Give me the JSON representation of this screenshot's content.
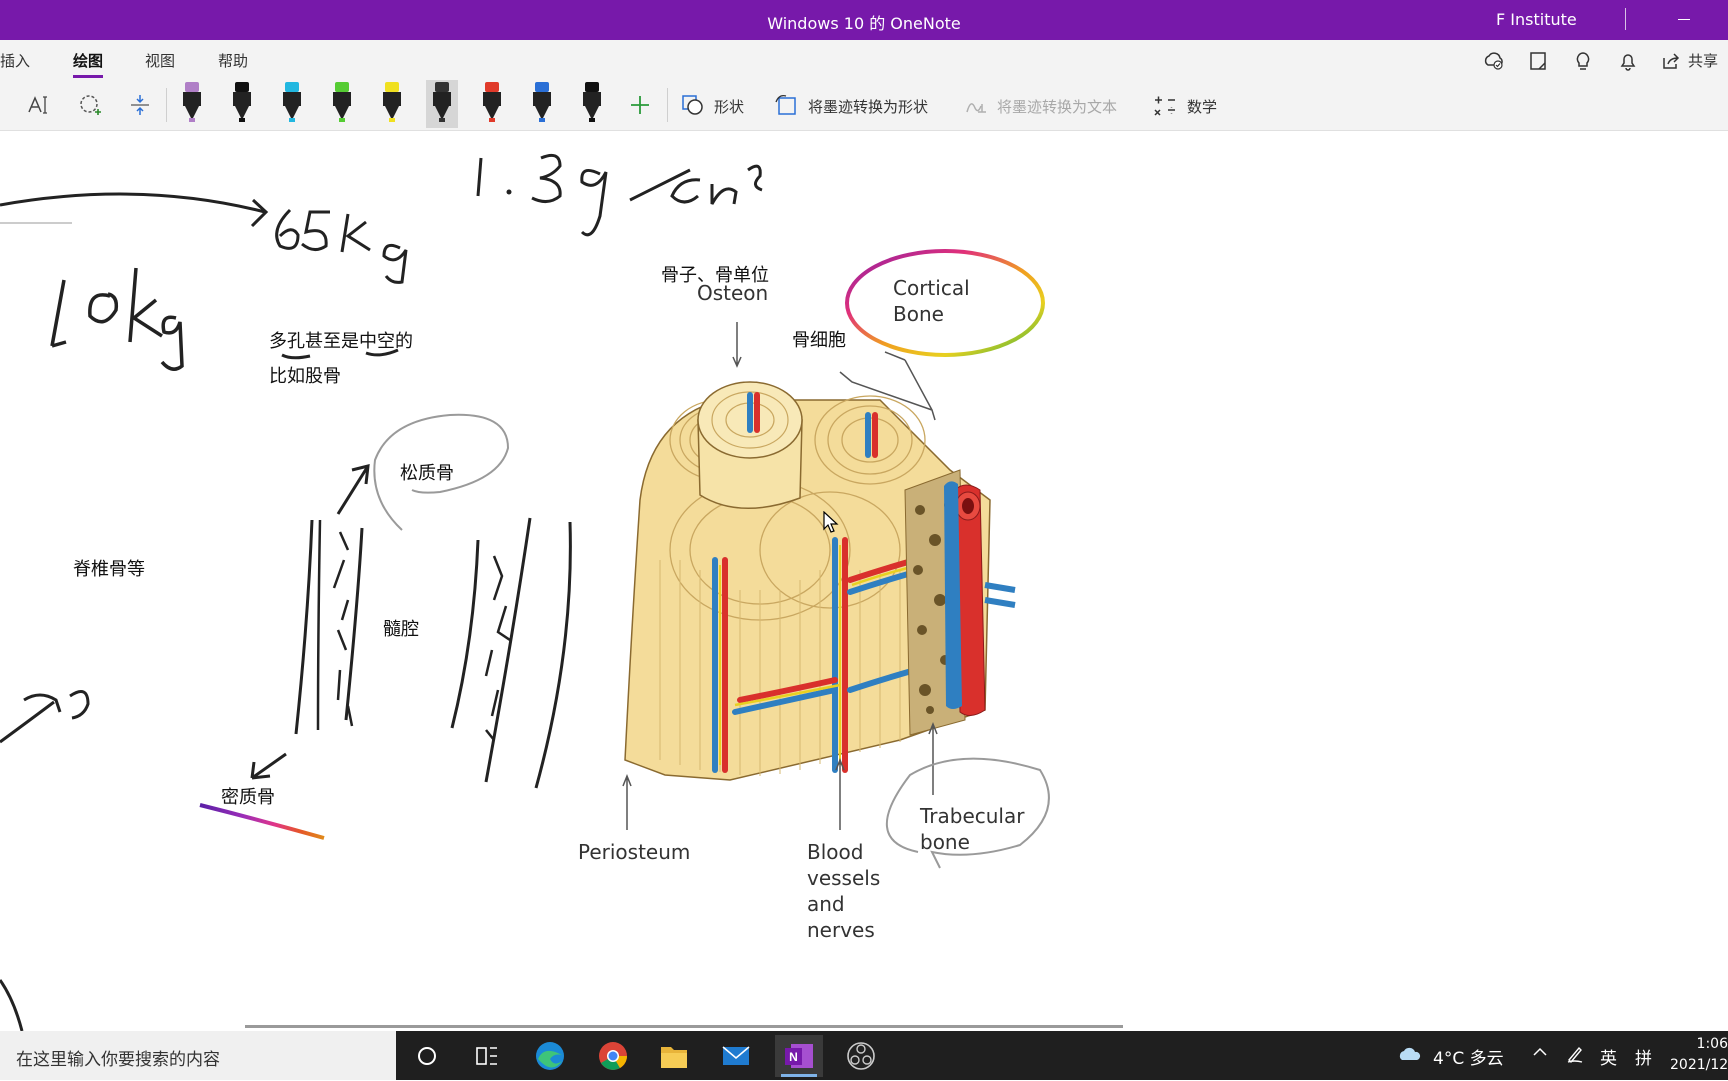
{
  "window": {
    "title": "Windows 10 的 OneNote",
    "account": "F Institute"
  },
  "tabs": [
    "插入",
    "绘图",
    "视图",
    "帮助"
  ],
  "header": {
    "share_label": "共享",
    "icons": [
      "sync-icon",
      "notebook-icon",
      "lightbulb-icon",
      "bell-icon",
      "share-icon"
    ]
  },
  "ribbon": {
    "pens": [
      {
        "name": "purple-highlighter",
        "color": "#b07fc7"
      },
      {
        "name": "black-pen-1",
        "color": "#111111"
      },
      {
        "name": "cyan-pen",
        "color": "#22b7e0"
      },
      {
        "name": "green-pen",
        "color": "#55cc33"
      },
      {
        "name": "yellow-highlighter",
        "color": "#f0e020"
      },
      {
        "name": "pencil",
        "color": "#333333"
      },
      {
        "name": "red-pen",
        "color": "#e03a2a"
      },
      {
        "name": "blue-pen",
        "color": "#2a6fd6"
      },
      {
        "name": "black-pen-2",
        "color": "#111111"
      }
    ],
    "shapes_label": "形状",
    "ink_to_shape_label": "将墨迹转换为形状",
    "ink_to_text_label": "将墨迹转换为文本",
    "math_label": "数学"
  },
  "note": {
    "porous_line1": "多孔甚至是中空的",
    "porous_line2": "比如股骨",
    "spine": "脊椎骨等",
    "spongy": "松质骨",
    "cavity": "髓腔",
    "compact": "密质骨",
    "osteon_zh": "骨子、骨单位",
    "osteocyte": "骨细胞"
  },
  "diagram": {
    "osteon": "Osteon",
    "cortical_line1": "Cortical",
    "cortical_line2": "Bone",
    "periosteum": "Periosteum",
    "vessels_line1": "Blood",
    "vessels_line2": "vessels",
    "vessels_line3": "and",
    "vessels_line4": "nerves",
    "trabecular_line1": "Trabecular",
    "trabecular_line2": "bone"
  },
  "taskbar": {
    "search_placeholder": "在这里输入你要搜索的内容",
    "apps": [
      "cortana-icon",
      "task-view-icon",
      "edge-icon",
      "chrome-icon",
      "file-explorer-icon",
      "mail-icon",
      "onenote-icon",
      "obs-icon"
    ],
    "weather": "4°C 多云",
    "ime_lang": "英",
    "ime_mode": "拼",
    "time": "1:06",
    "date": "2021/12"
  }
}
